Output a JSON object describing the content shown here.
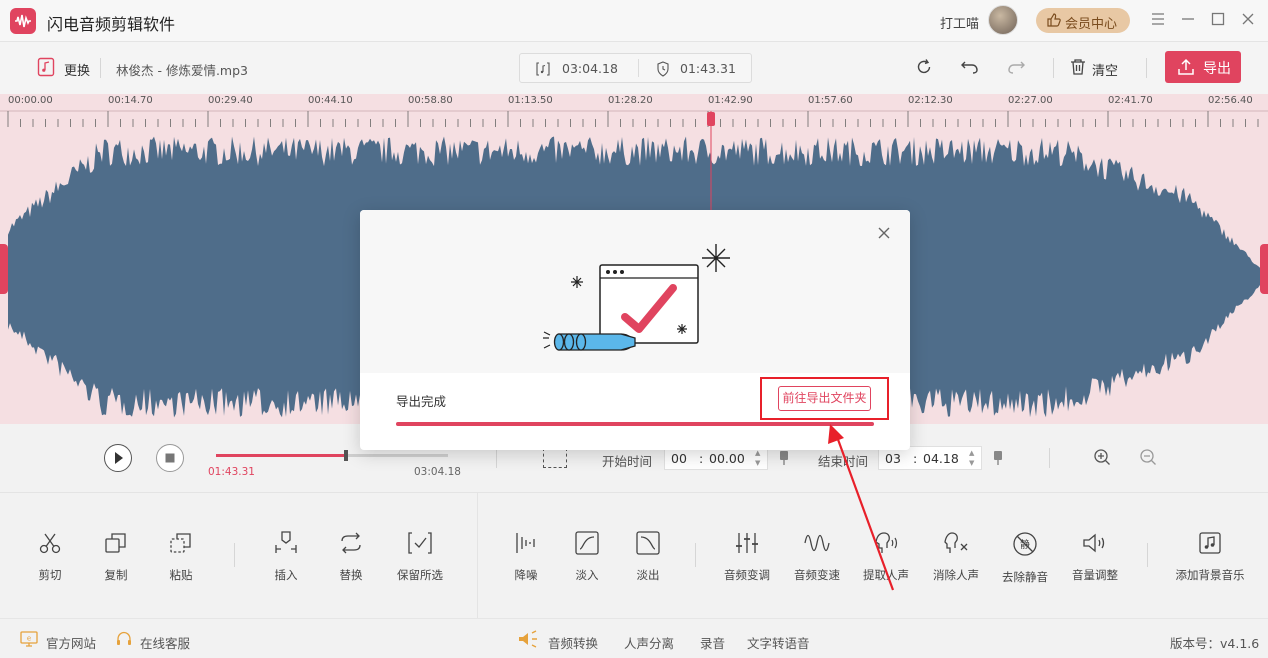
{
  "app": {
    "title": "闪电音频剪辑软件",
    "user_name": "打工喵",
    "vip_label": "会员中心"
  },
  "toolbar": {
    "replace_label": "更换",
    "file_name": "林俊杰 - 修炼爱情.mp3",
    "total_duration": "03:04.18",
    "current_duration": "01:43.31",
    "clear_label": "清空",
    "export_label": "导出"
  },
  "ruler": {
    "labels": [
      "00:00.00",
      "00:14.70",
      "00:29.40",
      "00:44.10",
      "00:58.80",
      "01:13.50",
      "01:28.20",
      "01:42.90",
      "01:57.60",
      "02:12.30",
      "02:27.00",
      "02:41.70",
      "02:56.40"
    ]
  },
  "playback": {
    "position": "01:43.31",
    "total": "03:04.18",
    "progress_fraction": 0.56,
    "start_label": "开始时间",
    "start_min": "00",
    "start_sec": "00.00",
    "end_label": "结束时间",
    "end_min": "03",
    "end_sec": "04.18",
    "colon": ":"
  },
  "tools": [
    {
      "label": "剪切",
      "icon": "scissors-icon"
    },
    {
      "label": "复制",
      "icon": "copy-icon"
    },
    {
      "label": "粘贴",
      "icon": "paste-icon"
    },
    {
      "label": "插入",
      "icon": "insert-icon"
    },
    {
      "label": "替换",
      "icon": "replace-icon"
    },
    {
      "label": "保留所选",
      "icon": "keep-selection-icon"
    },
    {
      "label": "降噪",
      "icon": "denoise-icon"
    },
    {
      "label": "淡入",
      "icon": "fade-in-icon"
    },
    {
      "label": "淡出",
      "icon": "fade-out-icon"
    },
    {
      "label": "音频变调",
      "icon": "pitch-icon"
    },
    {
      "label": "音频变速",
      "icon": "speed-icon"
    },
    {
      "label": "提取人声",
      "icon": "extract-vocal-icon"
    },
    {
      "label": "消除人声",
      "icon": "remove-vocal-icon"
    },
    {
      "label": "去除静音",
      "icon": "remove-silence-icon"
    },
    {
      "label": "音量调整",
      "icon": "volume-icon"
    },
    {
      "label": "添加背景音乐",
      "icon": "bg-music-icon"
    }
  ],
  "status": {
    "website": "官方网站",
    "support": "在线客服",
    "audio_convert": "音频转换",
    "vocal_separate": "人声分离",
    "record": "录音",
    "tts": "文字转语音",
    "version": "版本号：v4.1.6"
  },
  "modal": {
    "done_label": "导出完成",
    "open_folder_label": "前往导出文件夹",
    "progress_fraction": 1.0
  },
  "colors": {
    "accent": "#e0445f",
    "wave": "#4f6d8a",
    "annotation": "#e8202a"
  }
}
